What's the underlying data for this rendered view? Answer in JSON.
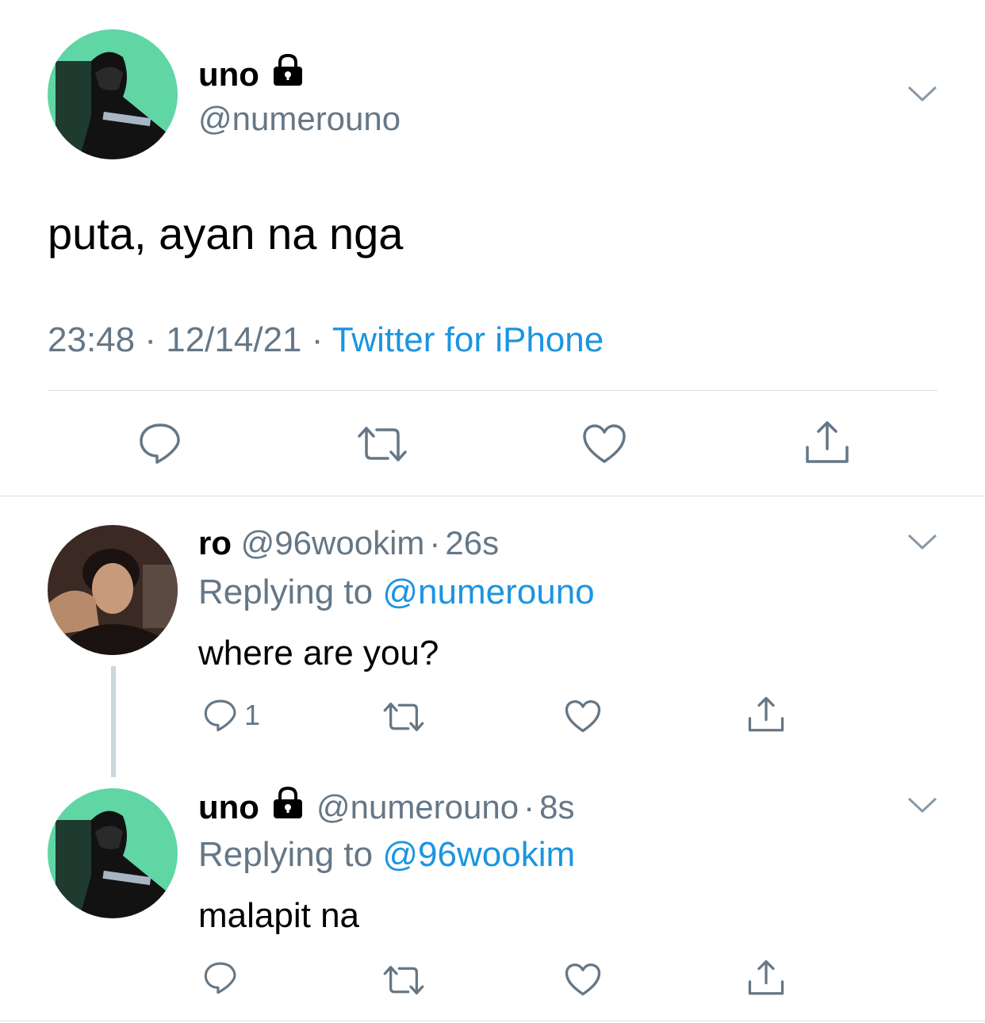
{
  "main_tweet": {
    "display_name": "uno",
    "handle": "@numerouno",
    "protected_icon": "lock-icon",
    "text": "puta, ayan na nga",
    "time": "23:48",
    "date": "12/14/21",
    "separator": "·",
    "source": "Twitter for iPhone",
    "avatar_colors": {
      "background": "#5fd6a4",
      "figure": "#121212"
    },
    "actions": [
      "reply-icon",
      "retweet-icon",
      "like-icon",
      "share-icon"
    ]
  },
  "replies": [
    {
      "display_name": "ro",
      "handle": "@96wookim",
      "separator": "·",
      "age": "26s",
      "replying_prefix": "Replying to",
      "replying_to": "@numerouno",
      "text": "where are you?",
      "reply_count": "1",
      "avatar_colors": {
        "background": "#3b2a24",
        "skin": "#c89a7c"
      }
    },
    {
      "display_name": "uno",
      "handle": "@numerouno",
      "separator": "·",
      "age": "8s",
      "replying_prefix": "Replying to",
      "replying_to": "@96wookim",
      "text": "malapit na",
      "reply_count": "",
      "protected_icon": "lock-icon"
    }
  ],
  "colors": {
    "text": "#000000",
    "secondary": "#657786",
    "link": "#1b95e0",
    "divider": "#d9dfe4",
    "thread_line": "#ccd6dd",
    "icon": "#657786"
  }
}
